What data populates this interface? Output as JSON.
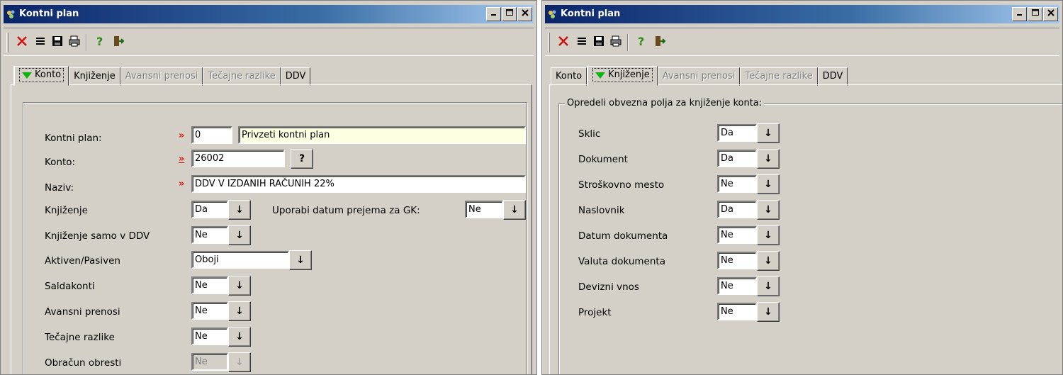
{
  "left_window": {
    "title": "Kontni plan",
    "tabs": [
      {
        "label": "Konto",
        "active": true,
        "disabled": false
      },
      {
        "label": "Knjiženje",
        "active": false,
        "disabled": false
      },
      {
        "label": "Avansni prenosi",
        "active": false,
        "disabled": true
      },
      {
        "label": "Tečajne razlike",
        "active": false,
        "disabled": true
      },
      {
        "label": "DDV",
        "active": false,
        "disabled": false
      }
    ],
    "form": {
      "required_marker": "»",
      "kontni_plan": {
        "label": "Kontni plan:",
        "code": "0",
        "name": "Privzeti kontni plan"
      },
      "konto": {
        "label": "Konto:",
        "value": "26002",
        "lookup": "?"
      },
      "naziv": {
        "label": "Naziv:",
        "value": "DDV V IZDANIH RAČUNIH 22%"
      },
      "knjizenje": {
        "label": "Knjiženje",
        "value": "Da"
      },
      "uporabi_datum": {
        "label": "Uporabi datum prejema za GK:",
        "value": "Ne"
      },
      "knjizenje_ddv": {
        "label": "Knjiženje samo v DDV",
        "value": "Ne"
      },
      "aktiven_pasiven": {
        "label": "Aktiven/Pasiven",
        "value": "Oboji"
      },
      "saldakonti": {
        "label": "Saldakonti",
        "value": "Ne"
      },
      "avansni_prenosi": {
        "label": "Avansni prenosi",
        "value": "Ne"
      },
      "tecajne_razlike": {
        "label": "Tečajne razlike",
        "value": "Ne"
      },
      "obracun_obresti": {
        "label": "Obračun obresti",
        "value": "Ne",
        "disabled": true
      }
    }
  },
  "right_window": {
    "title": "Kontni plan",
    "tabs": [
      {
        "label": "Konto",
        "active": false,
        "disabled": false
      },
      {
        "label": "Knjiženje",
        "active": true,
        "disabled": false
      },
      {
        "label": "Avansni prenosi",
        "active": false,
        "disabled": true
      },
      {
        "label": "Tečajne razlike",
        "active": false,
        "disabled": true
      },
      {
        "label": "DDV",
        "active": false,
        "disabled": false
      }
    ],
    "group_title": "Opredeli obvezna polja za knjiženje konta:",
    "fields": [
      {
        "label": "Sklic",
        "value": "Da"
      },
      {
        "label": "Dokument",
        "value": "Da"
      },
      {
        "label": "Stroškovno mesto",
        "value": "Ne"
      },
      {
        "label": "Naslovnik",
        "value": "Da"
      },
      {
        "label": "Datum dokumenta",
        "value": "Ne"
      },
      {
        "label": "Valuta dokumenta",
        "value": "Ne"
      },
      {
        "label": "Devizni vnos",
        "value": "Ne"
      },
      {
        "label": "Projekt",
        "value": "Ne"
      }
    ]
  },
  "icons": {
    "window": "app-icon",
    "title_buttons": [
      "minimize-icon",
      "maximize-icon",
      "close-icon"
    ],
    "toolbar": [
      "delete-icon",
      "list-icon",
      "save-icon",
      "print-icon",
      "help-icon",
      "exit-icon"
    ],
    "dropdown": "down-arrow-icon"
  },
  "colors": {
    "required_marker": "#e0180c",
    "title_bar": "#0a246a",
    "active_tab_marker": "#0bb40b"
  }
}
